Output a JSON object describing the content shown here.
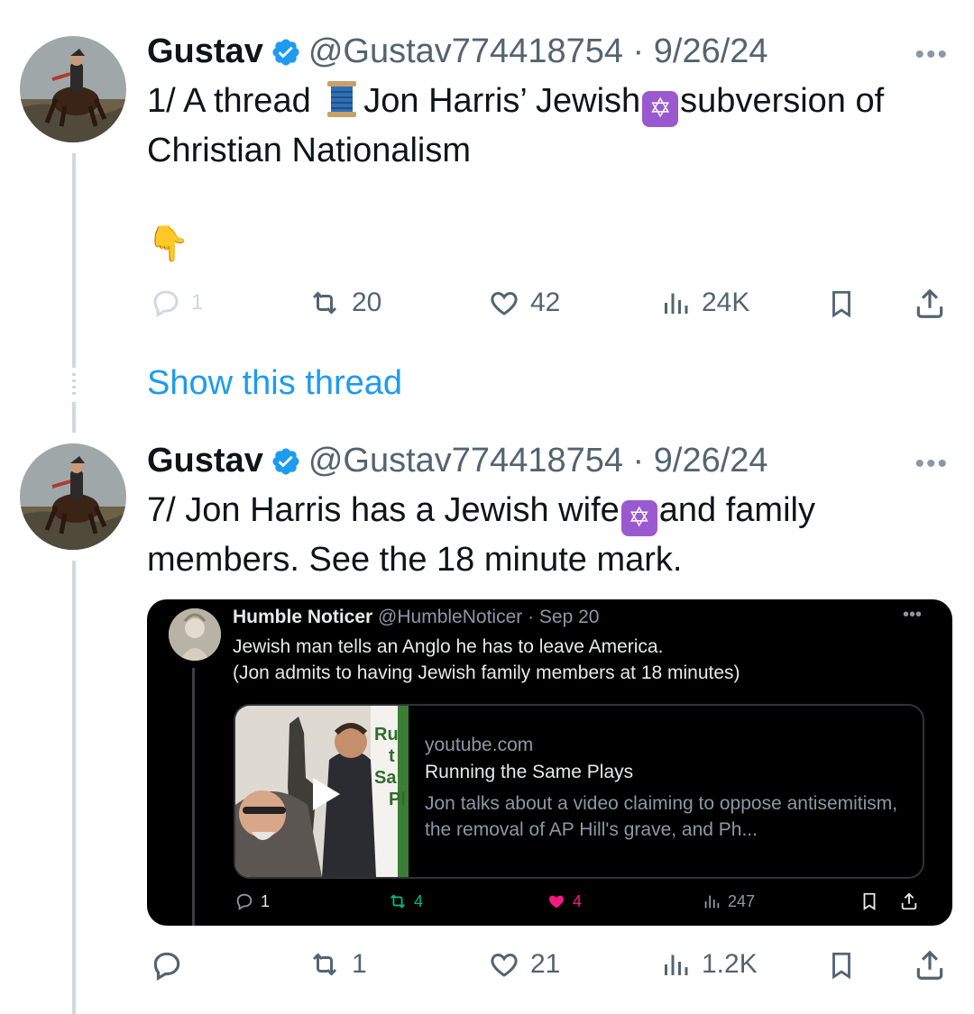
{
  "tweets": [
    {
      "name": "Gustav",
      "handle": "@Gustav774418754",
      "separator": " · ",
      "date": "9/26/24",
      "line1_a": "1/ A thread ",
      "line1_b": "Jon Harris’ Jewish",
      "line1_c": "subversion of",
      "line2": "Christian Nationalism",
      "pointer_emoji": "👇",
      "stats": {
        "replies": "1",
        "reposts": "20",
        "likes": "42",
        "views": "24K"
      }
    },
    {
      "name": "Gustav",
      "handle": "@Gustav774418754",
      "separator": " · ",
      "date": "9/26/24",
      "line1_a": "7/ Jon Harris has a Jewish wife",
      "line1_b": "and family",
      "line2": "members. See the 18 minute mark.",
      "stats": {
        "replies": "",
        "reposts": "1",
        "likes": "21",
        "views": "1.2K"
      }
    }
  ],
  "show_thread": "Show this thread",
  "more_icon": "•••",
  "icons": {
    "reply": "reply-icon",
    "repost": "repost-icon",
    "like": "heart-icon",
    "views": "views-icon",
    "bookmark": "bookmark-icon",
    "share": "share-icon",
    "verified": "verified-badge-icon",
    "star": "star-of-david-emoji",
    "thread": "spool-of-thread-emoji"
  },
  "quote": {
    "name": "Humble Noticer",
    "handle": "@HumbleNoticer",
    "separator": " · ",
    "date": "Sep 20",
    "text_line1": "Jewish man tells an Anglo he has to leave America.",
    "text_line2": "(Jon admits to having Jewish family members at 18 minutes)",
    "card": {
      "domain": "youtube.com",
      "title": "Running the Same Plays",
      "description": "Jon talks about a video claiming to oppose antisemitism, the removal of AP Hill's grave, and Ph...",
      "thumb_text": [
        "Ru",
        "t",
        "Sa",
        "Pl"
      ]
    },
    "stats": {
      "replies": "1",
      "reposts": "4",
      "likes": "4",
      "views": "247"
    }
  },
  "colors": {
    "link": "#1d9bf0",
    "verified": "#1d9bf0",
    "muted": "#536471",
    "like_active": "#f91880",
    "repost_green": "#00ba7c"
  }
}
